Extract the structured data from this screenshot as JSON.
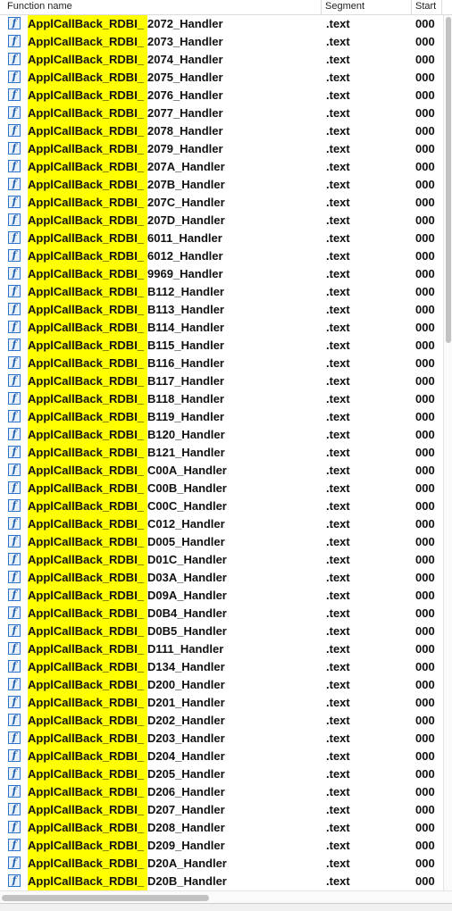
{
  "header": {
    "function_name": "Function name",
    "segment": "Segment",
    "start": "Start"
  },
  "rows": [
    {
      "name_prefix": "ApplCallBack_RDBI_",
      "name_suffix": "2072_Handler",
      "segment": ".text",
      "start": "000"
    },
    {
      "name_prefix": "ApplCallBack_RDBI_",
      "name_suffix": "2073_Handler",
      "segment": ".text",
      "start": "000"
    },
    {
      "name_prefix": "ApplCallBack_RDBI_",
      "name_suffix": "2074_Handler",
      "segment": ".text",
      "start": "000"
    },
    {
      "name_prefix": "ApplCallBack_RDBI_",
      "name_suffix": "2075_Handler",
      "segment": ".text",
      "start": "000"
    },
    {
      "name_prefix": "ApplCallBack_RDBI_",
      "name_suffix": "2076_Handler",
      "segment": ".text",
      "start": "000"
    },
    {
      "name_prefix": "ApplCallBack_RDBI_",
      "name_suffix": "2077_Handler",
      "segment": ".text",
      "start": "000"
    },
    {
      "name_prefix": "ApplCallBack_RDBI_",
      "name_suffix": "2078_Handler",
      "segment": ".text",
      "start": "000"
    },
    {
      "name_prefix": "ApplCallBack_RDBI_",
      "name_suffix": "2079_Handler",
      "segment": ".text",
      "start": "000"
    },
    {
      "name_prefix": "ApplCallBack_RDBI_",
      "name_suffix": "207A_Handler",
      "segment": ".text",
      "start": "000"
    },
    {
      "name_prefix": "ApplCallBack_RDBI_",
      "name_suffix": "207B_Handler",
      "segment": ".text",
      "start": "000"
    },
    {
      "name_prefix": "ApplCallBack_RDBI_",
      "name_suffix": "207C_Handler",
      "segment": ".text",
      "start": "000"
    },
    {
      "name_prefix": "ApplCallBack_RDBI_",
      "name_suffix": "207D_Handler",
      "segment": ".text",
      "start": "000"
    },
    {
      "name_prefix": "ApplCallBack_RDBI_",
      "name_suffix": "6011_Handler",
      "segment": ".text",
      "start": "000"
    },
    {
      "name_prefix": "ApplCallBack_RDBI_",
      "name_suffix": "6012_Handler",
      "segment": ".text",
      "start": "000"
    },
    {
      "name_prefix": "ApplCallBack_RDBI_",
      "name_suffix": "9969_Handler",
      "segment": ".text",
      "start": "000"
    },
    {
      "name_prefix": "ApplCallBack_RDBI_",
      "name_suffix": "B112_Handler",
      "segment": ".text",
      "start": "000"
    },
    {
      "name_prefix": "ApplCallBack_RDBI_",
      "name_suffix": "B113_Handler",
      "segment": ".text",
      "start": "000"
    },
    {
      "name_prefix": "ApplCallBack_RDBI_",
      "name_suffix": "B114_Handler",
      "segment": ".text",
      "start": "000"
    },
    {
      "name_prefix": "ApplCallBack_RDBI_",
      "name_suffix": "B115_Handler",
      "segment": ".text",
      "start": "000"
    },
    {
      "name_prefix": "ApplCallBack_RDBI_",
      "name_suffix": "B116_Handler",
      "segment": ".text",
      "start": "000"
    },
    {
      "name_prefix": "ApplCallBack_RDBI_",
      "name_suffix": "B117_Handler",
      "segment": ".text",
      "start": "000"
    },
    {
      "name_prefix": "ApplCallBack_RDBI_",
      "name_suffix": "B118_Handler",
      "segment": ".text",
      "start": "000"
    },
    {
      "name_prefix": "ApplCallBack_RDBI_",
      "name_suffix": "B119_Handler",
      "segment": ".text",
      "start": "000"
    },
    {
      "name_prefix": "ApplCallBack_RDBI_",
      "name_suffix": "B120_Handler",
      "segment": ".text",
      "start": "000"
    },
    {
      "name_prefix": "ApplCallBack_RDBI_",
      "name_suffix": "B121_Handler",
      "segment": ".text",
      "start": "000"
    },
    {
      "name_prefix": "ApplCallBack_RDBI_",
      "name_suffix": "C00A_Handler",
      "segment": ".text",
      "start": "000"
    },
    {
      "name_prefix": "ApplCallBack_RDBI_",
      "name_suffix": "C00B_Handler",
      "segment": ".text",
      "start": "000"
    },
    {
      "name_prefix": "ApplCallBack_RDBI_",
      "name_suffix": "C00C_Handler",
      "segment": ".text",
      "start": "000"
    },
    {
      "name_prefix": "ApplCallBack_RDBI_",
      "name_suffix": "C012_Handler",
      "segment": ".text",
      "start": "000"
    },
    {
      "name_prefix": "ApplCallBack_RDBI_",
      "name_suffix": "D005_Handler",
      "segment": ".text",
      "start": "000"
    },
    {
      "name_prefix": "ApplCallBack_RDBI_",
      "name_suffix": "D01C_Handler",
      "segment": ".text",
      "start": "000"
    },
    {
      "name_prefix": "ApplCallBack_RDBI_",
      "name_suffix": "D03A_Handler",
      "segment": ".text",
      "start": "000"
    },
    {
      "name_prefix": "ApplCallBack_RDBI_",
      "name_suffix": "D09A_Handler",
      "segment": ".text",
      "start": "000"
    },
    {
      "name_prefix": "ApplCallBack_RDBI_",
      "name_suffix": "D0B4_Handler",
      "segment": ".text",
      "start": "000"
    },
    {
      "name_prefix": "ApplCallBack_RDBI_",
      "name_suffix": "D0B5_Handler",
      "segment": ".text",
      "start": "000"
    },
    {
      "name_prefix": "ApplCallBack_RDBI_",
      "name_suffix": "D111_Handler",
      "segment": ".text",
      "start": "000"
    },
    {
      "name_prefix": "ApplCallBack_RDBI_",
      "name_suffix": "D134_Handler",
      "segment": ".text",
      "start": "000"
    },
    {
      "name_prefix": "ApplCallBack_RDBI_",
      "name_suffix": "D200_Handler",
      "segment": ".text",
      "start": "000"
    },
    {
      "name_prefix": "ApplCallBack_RDBI_",
      "name_suffix": "D201_Handler",
      "segment": ".text",
      "start": "000"
    },
    {
      "name_prefix": "ApplCallBack_RDBI_",
      "name_suffix": "D202_Handler",
      "segment": ".text",
      "start": "000"
    },
    {
      "name_prefix": "ApplCallBack_RDBI_",
      "name_suffix": "D203_Handler",
      "segment": ".text",
      "start": "000"
    },
    {
      "name_prefix": "ApplCallBack_RDBI_",
      "name_suffix": "D204_Handler",
      "segment": ".text",
      "start": "000"
    },
    {
      "name_prefix": "ApplCallBack_RDBI_",
      "name_suffix": "D205_Handler",
      "segment": ".text",
      "start": "000"
    },
    {
      "name_prefix": "ApplCallBack_RDBI_",
      "name_suffix": "D206_Handler",
      "segment": ".text",
      "start": "000"
    },
    {
      "name_prefix": "ApplCallBack_RDBI_",
      "name_suffix": "D207_Handler",
      "segment": ".text",
      "start": "000"
    },
    {
      "name_prefix": "ApplCallBack_RDBI_",
      "name_suffix": "D208_Handler",
      "segment": ".text",
      "start": "000"
    },
    {
      "name_prefix": "ApplCallBack_RDBI_",
      "name_suffix": "D209_Handler",
      "segment": ".text",
      "start": "000"
    },
    {
      "name_prefix": "ApplCallBack_RDBI_",
      "name_suffix": "D20A_Handler",
      "segment": ".text",
      "start": "000"
    },
    {
      "name_prefix": "ApplCallBack_RDBI_",
      "name_suffix": "D20B_Handler",
      "segment": ".text",
      "start": "000"
    }
  ],
  "icons": {
    "function": "function-icon"
  },
  "colors": {
    "highlight": "#ffff00",
    "icon_blue": "#2a73c9"
  }
}
